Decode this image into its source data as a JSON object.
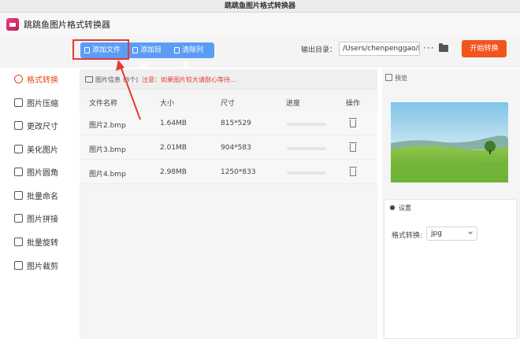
{
  "window": {
    "title": "跳跳鱼图片格式转换器"
  },
  "app": {
    "title": "跳跳鱼图片格式转换器"
  },
  "toolbar": {
    "add_file": "添加文件",
    "add_folder": "添加目录",
    "clear_list": "清除列表",
    "output_label": "输出目录：",
    "output_path": "/Users/chenpenggao/D",
    "more": "···",
    "start": "开始转换"
  },
  "sidebar": {
    "items": [
      {
        "label": "格式转换",
        "icon": "format-convert-icon",
        "active": true
      },
      {
        "label": "图片压缩",
        "icon": "compress-icon"
      },
      {
        "label": "更改尺寸",
        "icon": "resize-icon"
      },
      {
        "label": "美化图片",
        "icon": "beautify-icon"
      },
      {
        "label": "图片圆角",
        "icon": "round-corner-icon"
      },
      {
        "label": "批量命名",
        "icon": "rename-icon"
      },
      {
        "label": "图片拼接",
        "icon": "stitch-icon"
      },
      {
        "label": "批量旋转",
        "icon": "rotate-icon"
      },
      {
        "label": "图片裁剪",
        "icon": "crop-icon"
      }
    ]
  },
  "info": {
    "label": "图片信息",
    "count": "(3个)",
    "note": "注意：如果图片较大请耐心等待..."
  },
  "table": {
    "headers": [
      "文件名称",
      "大小",
      "尺寸",
      "进度",
      "操作"
    ],
    "rows": [
      {
        "name": "图片2.bmp",
        "size": "1.64MB",
        "dims": "815*529",
        "progress": 0
      },
      {
        "name": "图片3.bmp",
        "size": "2.01MB",
        "dims": "904*583",
        "progress": 0
      },
      {
        "name": "图片4.bmp",
        "size": "2.98MB",
        "dims": "1250*833",
        "progress": 0
      }
    ]
  },
  "preview": {
    "label": "预览"
  },
  "settings": {
    "label": "设置",
    "format_label": "格式转换:",
    "format_value": "jpg"
  },
  "colors": {
    "primary": "#5b9df5",
    "start": "#f2551c",
    "active": "#e64a19",
    "annotation": "#e53935"
  }
}
